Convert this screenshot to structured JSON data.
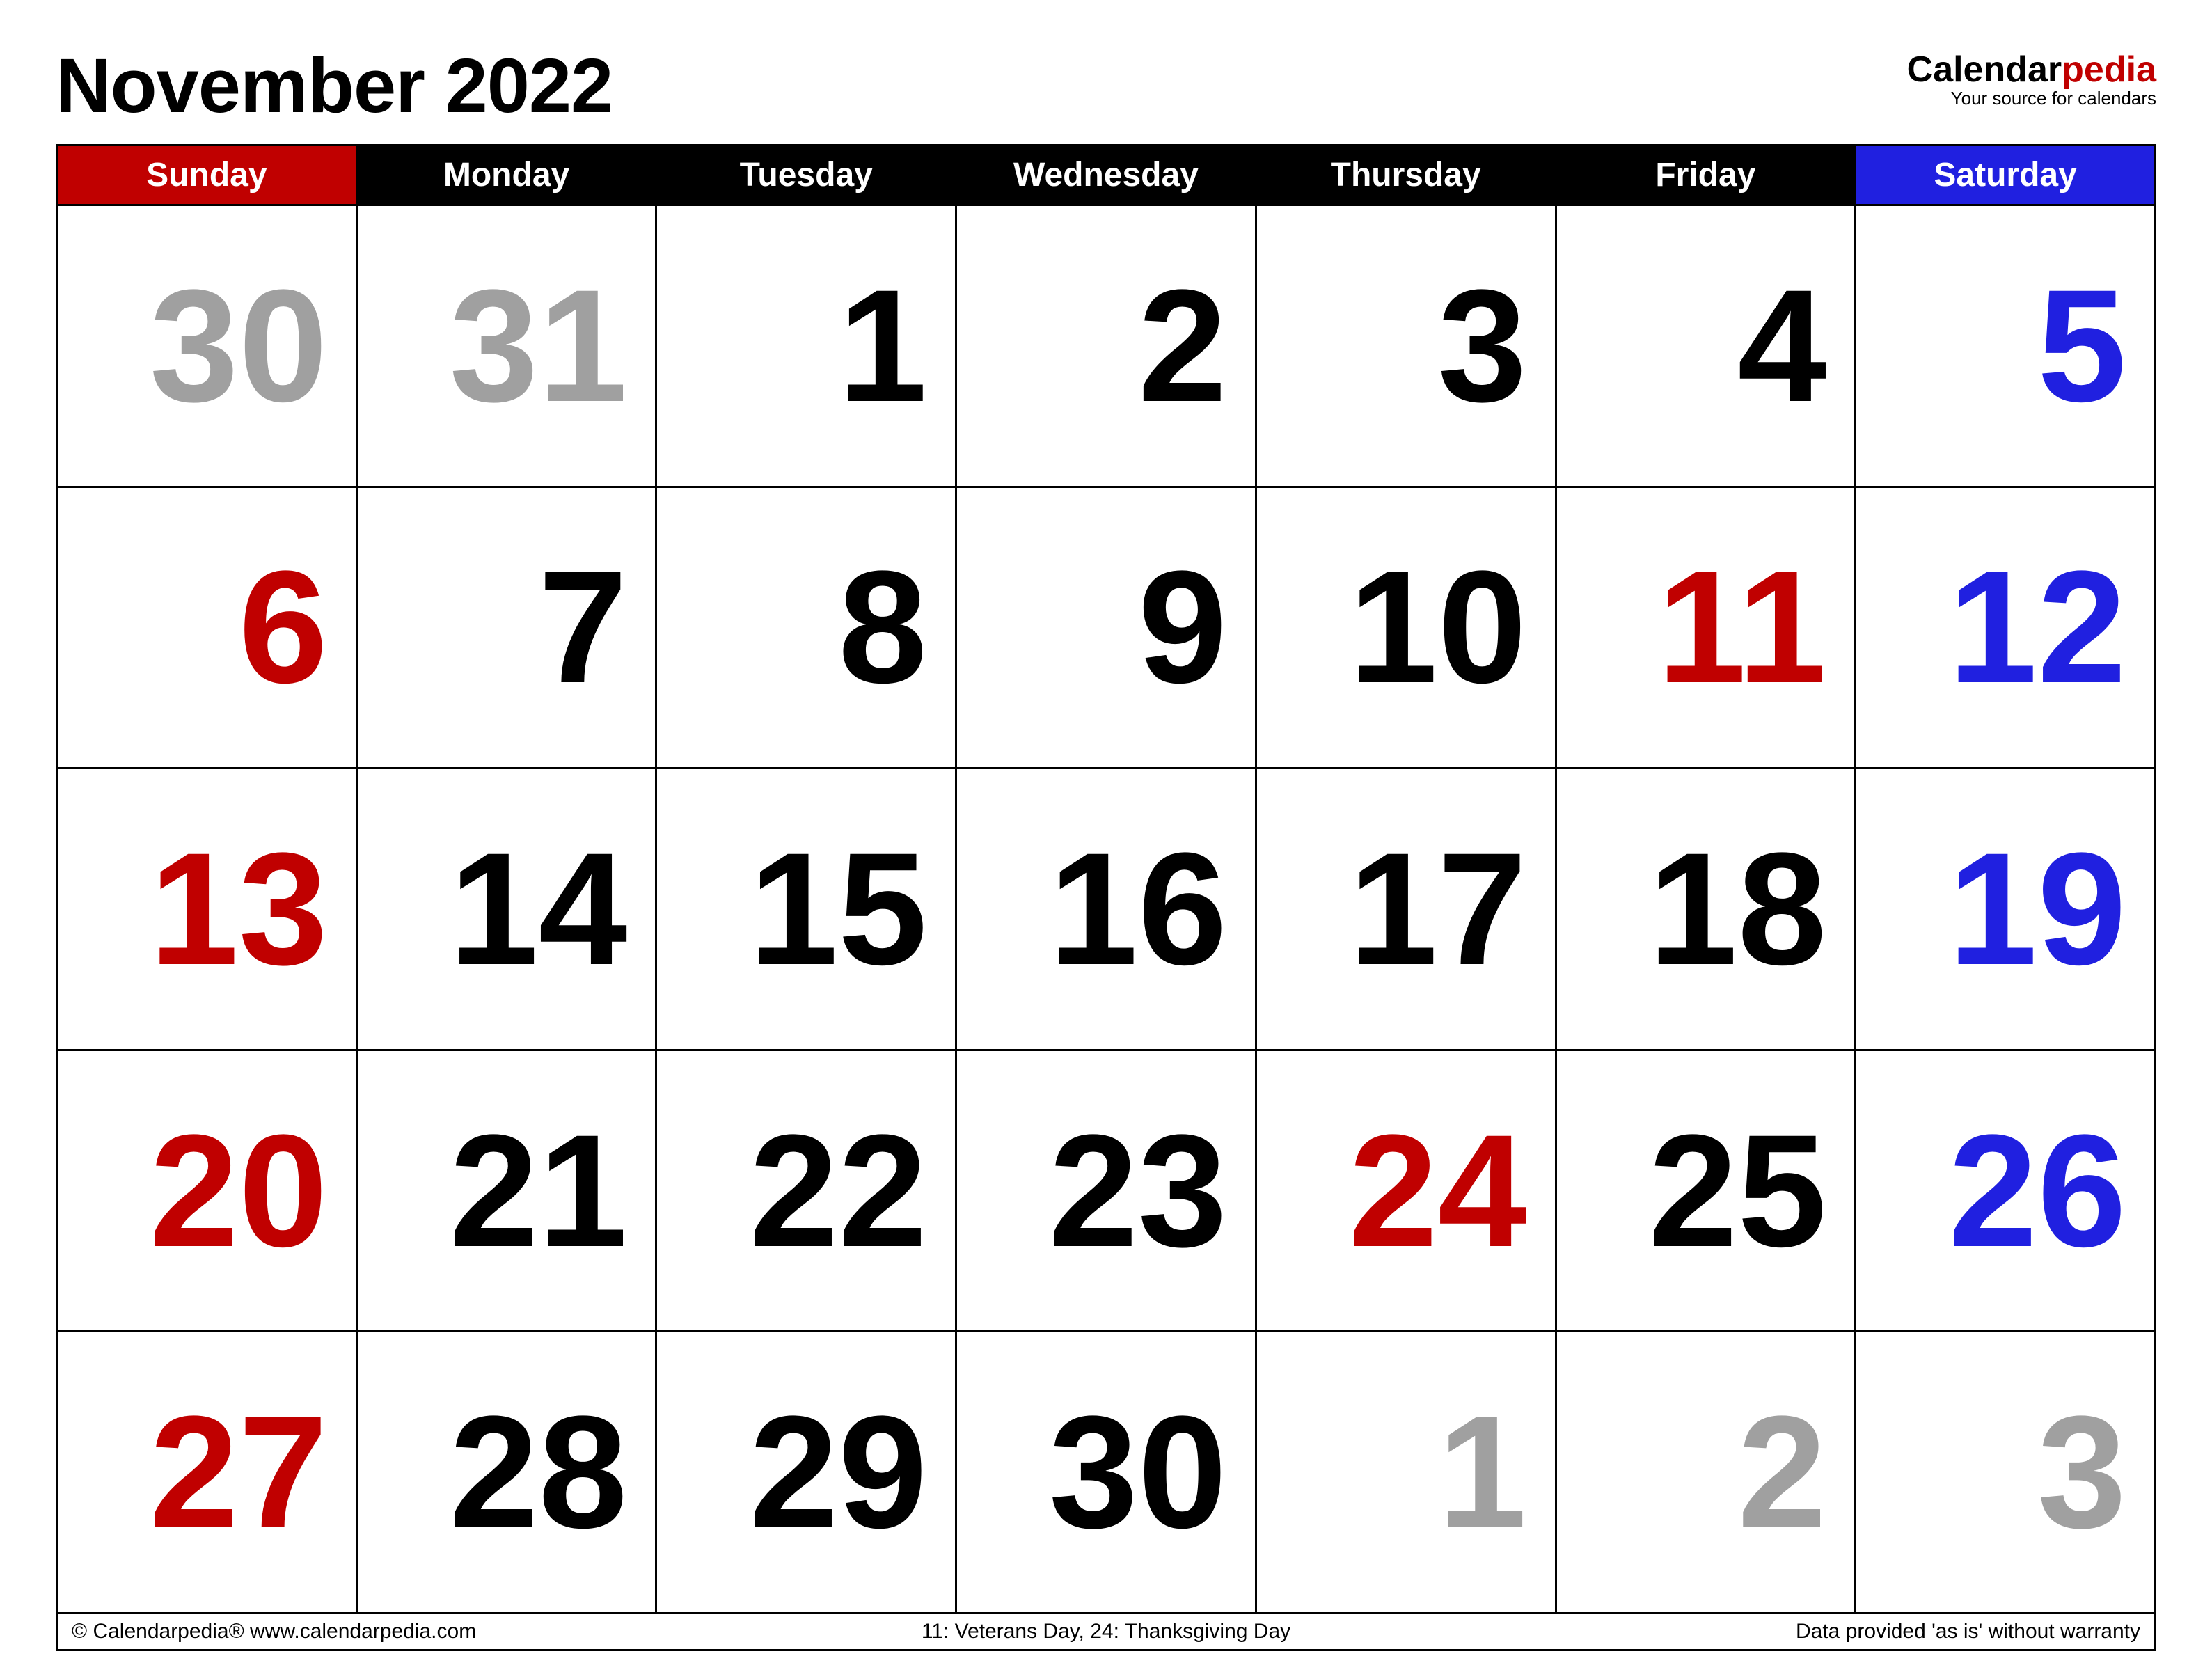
{
  "title": "November 2022",
  "brand": {
    "part1": "Calendar",
    "part2": "pedia",
    "tagline": "Your source for calendars"
  },
  "days": [
    "Sunday",
    "Monday",
    "Tuesday",
    "Wednesday",
    "Thursday",
    "Friday",
    "Saturday"
  ],
  "weeks": [
    [
      {
        "n": "30",
        "c": "grey"
      },
      {
        "n": "31",
        "c": "grey"
      },
      {
        "n": "1",
        "c": "black"
      },
      {
        "n": "2",
        "c": "black"
      },
      {
        "n": "3",
        "c": "black"
      },
      {
        "n": "4",
        "c": "black"
      },
      {
        "n": "5",
        "c": "blue"
      }
    ],
    [
      {
        "n": "6",
        "c": "red"
      },
      {
        "n": "7",
        "c": "black"
      },
      {
        "n": "8",
        "c": "black"
      },
      {
        "n": "9",
        "c": "black"
      },
      {
        "n": "10",
        "c": "black"
      },
      {
        "n": "11",
        "c": "red"
      },
      {
        "n": "12",
        "c": "blue"
      }
    ],
    [
      {
        "n": "13",
        "c": "red"
      },
      {
        "n": "14",
        "c": "black"
      },
      {
        "n": "15",
        "c": "black"
      },
      {
        "n": "16",
        "c": "black"
      },
      {
        "n": "17",
        "c": "black"
      },
      {
        "n": "18",
        "c": "black"
      },
      {
        "n": "19",
        "c": "blue"
      }
    ],
    [
      {
        "n": "20",
        "c": "red"
      },
      {
        "n": "21",
        "c": "black"
      },
      {
        "n": "22",
        "c": "black"
      },
      {
        "n": "23",
        "c": "black"
      },
      {
        "n": "24",
        "c": "red"
      },
      {
        "n": "25",
        "c": "black"
      },
      {
        "n": "26",
        "c": "blue"
      }
    ],
    [
      {
        "n": "27",
        "c": "red"
      },
      {
        "n": "28",
        "c": "black"
      },
      {
        "n": "29",
        "c": "black"
      },
      {
        "n": "30",
        "c": "black"
      },
      {
        "n": "1",
        "c": "grey"
      },
      {
        "n": "2",
        "c": "grey"
      },
      {
        "n": "3",
        "c": "grey"
      }
    ]
  ],
  "footer": {
    "left": "© Calendarpedia®   www.calendarpedia.com",
    "mid": "11: Veterans Day, 24: Thanksgiving Day",
    "right": "Data provided 'as is' without warranty"
  }
}
